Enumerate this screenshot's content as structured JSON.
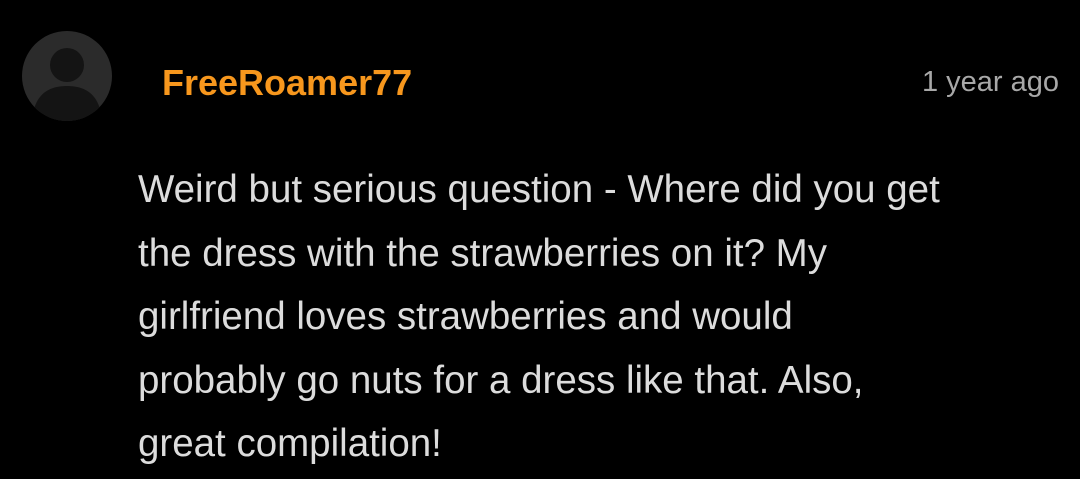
{
  "comment": {
    "avatar_icon": "default-user-silhouette-icon",
    "username": "FreeRoamer77",
    "timestamp": "1 year ago",
    "body_lines": [
      "Weird but serious question - Where did you get",
      "the dress with the strawberries on it? My",
      "girlfriend loves strawberries and would",
      "probably go nuts for a dress like that. Also,",
      "great compilation!"
    ]
  },
  "colors": {
    "background": "#000000",
    "username": "#f7971d",
    "timestamp": "#a8a8a8",
    "body_text": "#dcdcdc",
    "avatar_bg": "#2b2b2b",
    "avatar_silhouette": "#141414"
  }
}
